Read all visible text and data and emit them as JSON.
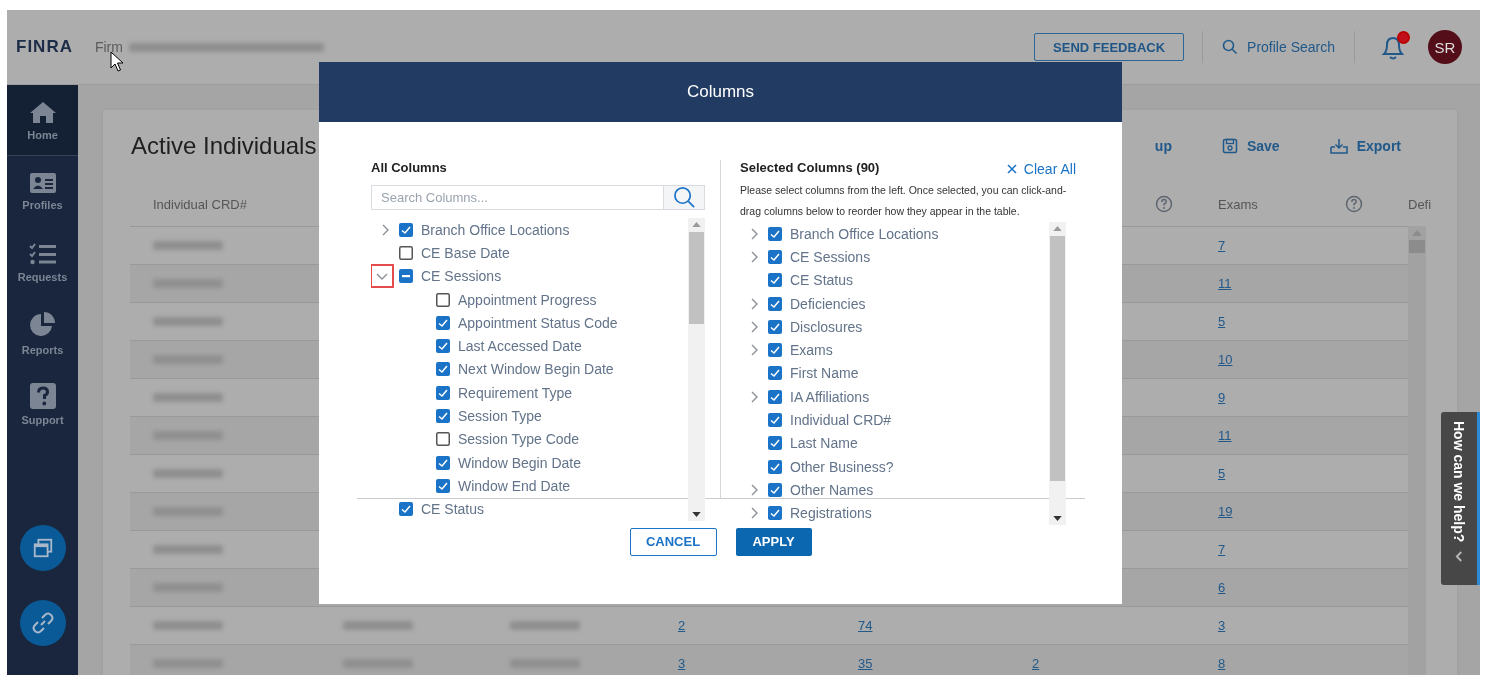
{
  "header": {
    "logo": "FINRA",
    "firm_label": "Firm",
    "feedback_button": "SEND FEEDBACK",
    "profile_search": "Profile Search",
    "has_unread": true,
    "avatar": "SR"
  },
  "sidebar": {
    "items": [
      {
        "label": "Home",
        "selected": true
      },
      {
        "label": "Profiles",
        "selected": false
      },
      {
        "label": "Requests",
        "selected": false
      },
      {
        "label": "Reports",
        "selected": false
      },
      {
        "label": "Support",
        "selected": false
      }
    ]
  },
  "page": {
    "title": "Active Individuals",
    "toolbar": [
      {
        "label": "up",
        "kind": "partial"
      },
      {
        "label": "Save",
        "kind": "save"
      },
      {
        "label": "Export",
        "kind": "export"
      }
    ],
    "table": {
      "columns": [
        {
          "label": "Individual CRD#",
          "help": false
        },
        {},
        {},
        {},
        {},
        {
          "help": true
        },
        {
          "label": "Exams",
          "help": true
        },
        {
          "label": "Defi",
          "help": false
        }
      ],
      "rows": [
        {
          "cells": [
            {
              "kind": "blurred"
            },
            {
              "kind": "none"
            },
            {
              "kind": "none"
            },
            {
              "kind": "none"
            },
            {
              "kind": "none"
            },
            {
              "kind": "none"
            },
            {
              "kind": "link",
              "text": "7"
            },
            {
              "kind": "none"
            }
          ]
        },
        {
          "cells": [
            {
              "kind": "blurred"
            },
            {
              "kind": "none"
            },
            {
              "kind": "none"
            },
            {
              "kind": "none"
            },
            {
              "kind": "none"
            },
            {
              "kind": "none"
            },
            {
              "kind": "link",
              "text": "11"
            },
            {
              "kind": "none"
            }
          ]
        },
        {
          "cells": [
            {
              "kind": "blurred"
            },
            {
              "kind": "none"
            },
            {
              "kind": "none"
            },
            {
              "kind": "none"
            },
            {
              "kind": "none"
            },
            {
              "kind": "none"
            },
            {
              "kind": "link",
              "text": "5"
            },
            {
              "kind": "none"
            }
          ]
        },
        {
          "cells": [
            {
              "kind": "blurred"
            },
            {
              "kind": "none"
            },
            {
              "kind": "none"
            },
            {
              "kind": "none"
            },
            {
              "kind": "none"
            },
            {
              "kind": "none"
            },
            {
              "kind": "link",
              "text": "10"
            },
            {
              "kind": "none"
            }
          ]
        },
        {
          "cells": [
            {
              "kind": "blurred"
            },
            {
              "kind": "none"
            },
            {
              "kind": "none"
            },
            {
              "kind": "none"
            },
            {
              "kind": "none"
            },
            {
              "kind": "none"
            },
            {
              "kind": "link",
              "text": "9"
            },
            {
              "kind": "none"
            }
          ]
        },
        {
          "cells": [
            {
              "kind": "blurred"
            },
            {
              "kind": "none"
            },
            {
              "kind": "none"
            },
            {
              "kind": "none"
            },
            {
              "kind": "none"
            },
            {
              "kind": "none"
            },
            {
              "kind": "link",
              "text": "11"
            },
            {
              "kind": "none"
            }
          ]
        },
        {
          "cells": [
            {
              "kind": "blurred"
            },
            {
              "kind": "none"
            },
            {
              "kind": "none"
            },
            {
              "kind": "none"
            },
            {
              "kind": "none"
            },
            {
              "kind": "none"
            },
            {
              "kind": "link",
              "text": "5"
            },
            {
              "kind": "none"
            }
          ]
        },
        {
          "cells": [
            {
              "kind": "blurred"
            },
            {
              "kind": "none"
            },
            {
              "kind": "none"
            },
            {
              "kind": "none"
            },
            {
              "kind": "none"
            },
            {
              "kind": "none"
            },
            {
              "kind": "link",
              "text": "19"
            },
            {
              "kind": "none"
            }
          ]
        },
        {
          "cells": [
            {
              "kind": "blurred"
            },
            {
              "kind": "none"
            },
            {
              "kind": "none"
            },
            {
              "kind": "none"
            },
            {
              "kind": "none"
            },
            {
              "kind": "none"
            },
            {
              "kind": "link",
              "text": "7"
            },
            {
              "kind": "none"
            }
          ]
        },
        {
          "cells": [
            {
              "kind": "blurred"
            },
            {
              "kind": "none"
            },
            {
              "kind": "none"
            },
            {
              "kind": "none"
            },
            {
              "kind": "none"
            },
            {
              "kind": "none"
            },
            {
              "kind": "link",
              "text": "6"
            },
            {
              "kind": "none"
            }
          ]
        },
        {
          "cells": [
            {
              "kind": "blurred"
            },
            {
              "kind": "blurred"
            },
            {
              "kind": "blurred"
            },
            {
              "kind": "link",
              "text": "2"
            },
            {
              "kind": "link",
              "text": "74"
            },
            {
              "kind": "none"
            },
            {
              "kind": "link",
              "text": "3"
            },
            {
              "kind": "none"
            }
          ]
        },
        {
          "cells": [
            {
              "kind": "blurred"
            },
            {
              "kind": "blurred"
            },
            {
              "kind": "blurred"
            },
            {
              "kind": "link",
              "text": "3"
            },
            {
              "kind": "link",
              "text": "35"
            },
            {
              "kind": "link",
              "text": "2"
            },
            {
              "kind": "link",
              "text": "8"
            },
            {
              "kind": "none"
            }
          ]
        }
      ]
    }
  },
  "help_tab": {
    "label": "How can we help?"
  },
  "modal": {
    "title": "Columns",
    "all_columns": {
      "title": "All Columns",
      "placeholder": "Search Columns...",
      "items": [
        {
          "label": "Branch Office Locations",
          "checked": true,
          "indeterminate": false,
          "expanded": false,
          "highlighted": false
        },
        {
          "label": "CE Base Date",
          "checked": false,
          "indeterminate": false,
          "highlighted": false
        },
        {
          "label": "CE Sessions",
          "indeterminate": true,
          "expanded": true,
          "highlighted": true,
          "children": [
            {
              "label": "Appointment Progress",
              "checked": false
            },
            {
              "label": "Appointment Status Code",
              "checked": true
            },
            {
              "label": "Last Accessed Date",
              "checked": true
            },
            {
              "label": "Next Window Begin Date",
              "checked": true
            },
            {
              "label": "Requirement Type",
              "checked": true
            },
            {
              "label": "Session Type",
              "checked": true
            },
            {
              "label": "Session Type Code",
              "checked": false
            },
            {
              "label": "Window Begin Date",
              "checked": true
            },
            {
              "label": "Window End Date",
              "checked": true
            }
          ]
        },
        {
          "label": "CE Status",
          "checked": true,
          "indeterminate": false,
          "highlighted": false
        }
      ]
    },
    "selected_columns": {
      "title": "Selected Columns (90)",
      "clear_all": "Clear All",
      "hint": "Please select columns from the left. Once selected, you can click-and-drag columns below to reorder how they appear in the table.",
      "items": [
        {
          "label": "Branch Office Locations",
          "checked": true,
          "expanded": false
        },
        {
          "label": "CE Sessions",
          "checked": true,
          "expanded": false
        },
        {
          "label": "CE Status",
          "checked": true
        },
        {
          "label": "Deficiencies",
          "checked": true,
          "expanded": false
        },
        {
          "label": "Disclosures",
          "checked": true,
          "expanded": false
        },
        {
          "label": "Exams",
          "checked": true,
          "expanded": false
        },
        {
          "label": "First Name",
          "checked": true
        },
        {
          "label": "IA Affiliations",
          "checked": true,
          "expanded": false
        },
        {
          "label": "Individual CRD#",
          "checked": true
        },
        {
          "label": "Last Name",
          "checked": true
        },
        {
          "label": "Other Business?",
          "checked": true
        },
        {
          "label": "Other Names",
          "checked": true,
          "expanded": false
        },
        {
          "label": "Registrations",
          "checked": true,
          "expanded": false
        }
      ]
    },
    "buttons": [
      {
        "label": "CANCEL",
        "kind": "secondary"
      },
      {
        "label": "APPLY",
        "kind": "primary"
      }
    ]
  }
}
